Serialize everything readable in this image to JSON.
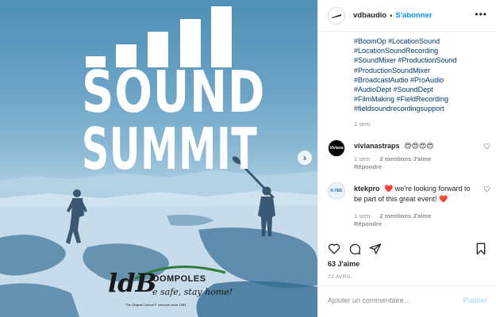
{
  "post": {
    "image": {
      "logo_line1": "SOUND",
      "logo_line2": "SUMMIT",
      "brand_letters": "ldB",
      "brand_name": "OOMPOLES",
      "brand_slogan": "e safe, stay home!",
      "brand_tagline": "The Original Carbon F   oompole since 1984",
      "next_icon": "chevron-right-icon"
    },
    "header": {
      "username": "vdbaudio",
      "separator": "•",
      "follow_label": "S'abonner",
      "more_icon": "more-horizontal-icon"
    },
    "caption": {
      "hashtags": [
        "#BoomOp #LocationSound",
        "#LocationSoundRecording",
        "#SoundMixer #ProductionSound",
        "#ProductionSoundMixer",
        "#BroadcastAudio #ProAudio",
        "#AudioDept #SoundDept",
        "#FilmMaking #FieldRecording",
        "#fieldsoundrecordingsupport"
      ],
      "time": "1 sem"
    },
    "comments": [
      {
        "username": "vivianastraps",
        "avatar_text": "Viviana",
        "text": "😍😍😍😍",
        "time": "1 sem",
        "likes": "2 mentions J'aime",
        "reply": "Répondre"
      },
      {
        "username": "ktekpro",
        "avatar_text": "K-TEK",
        "text": "❤️ we're looking forward to be part of this great event! ❤️",
        "time": "1 sem",
        "likes": "2 mentions J'aime",
        "reply": "Répondre"
      }
    ],
    "likes": "63 J'aime",
    "date": "22 AVRIL",
    "add_comment": {
      "placeholder": "Ajouter un commentaire...",
      "publish_label": "Publier"
    },
    "colors": {
      "accent": "#0095f6",
      "hashtag": "#00376b",
      "muted": "#8e8e8e",
      "publish_disabled": "#b2dffc"
    }
  }
}
